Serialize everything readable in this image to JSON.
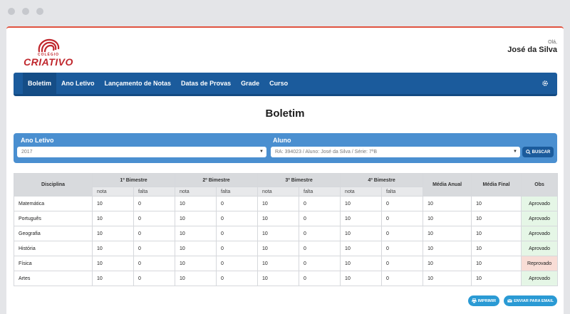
{
  "brand": {
    "small": "COLÉGIO",
    "big": "CRIATIVO",
    "color": "#c0272d"
  },
  "greeting": {
    "hi": "Olá,",
    "user": "José da Silva"
  },
  "nav": {
    "items": [
      "Boletim",
      "Ano Letivo",
      "Lançamento de Notas",
      "Datas de Provas",
      "Grade",
      "Curso"
    ],
    "active": "Boletim",
    "settings_icon": "gear-icon",
    "color": "#1b5b9c"
  },
  "page_title": "Boletim",
  "filter": {
    "year_label": "Ano Letivo",
    "year_value": "2017",
    "student_label": "Aluno",
    "student_value": "RA: 394023 / Aluno: José da Silva / Série: 7ºB",
    "search_label": "BUSCAR"
  },
  "table": {
    "headers": [
      "Disciplina",
      "1º Bimestre",
      "2º Bimestre",
      "3º Bimestre",
      "4º Bimestre",
      "Média Anual",
      "Média Final",
      "Obs"
    ],
    "sub": [
      "nota",
      "falta"
    ],
    "rows": [
      {
        "subject": "Matemática",
        "b1n": "10",
        "b1f": "0",
        "b2n": "10",
        "b2f": "0",
        "b3n": "10",
        "b3f": "0",
        "b4n": "10",
        "b4f": "0",
        "anual": "10",
        "final": "10",
        "obs": "Aprovado"
      },
      {
        "subject": "Português",
        "b1n": "10",
        "b1f": "0",
        "b2n": "10",
        "b2f": "0",
        "b3n": "10",
        "b3f": "0",
        "b4n": "10",
        "b4f": "0",
        "anual": "10",
        "final": "10",
        "obs": "Aprovado"
      },
      {
        "subject": "Geografia",
        "b1n": "10",
        "b1f": "0",
        "b2n": "10",
        "b2f": "0",
        "b3n": "10",
        "b3f": "0",
        "b4n": "10",
        "b4f": "0",
        "anual": "10",
        "final": "10",
        "obs": "Aprovado"
      },
      {
        "subject": "História",
        "b1n": "10",
        "b1f": "0",
        "b2n": "10",
        "b2f": "0",
        "b3n": "10",
        "b3f": "0",
        "b4n": "10",
        "b4f": "0",
        "anual": "10",
        "final": "10",
        "obs": "Aprovado"
      },
      {
        "subject": "Física",
        "b1n": "10",
        "b1f": "0",
        "b2n": "10",
        "b2f": "0",
        "b3n": "10",
        "b3f": "0",
        "b4n": "10",
        "b4f": "0",
        "anual": "10",
        "final": "10",
        "obs": "Reprovado"
      },
      {
        "subject": "Artes",
        "b1n": "10",
        "b1f": "0",
        "b2n": "10",
        "b2f": "0",
        "b3n": "10",
        "b3f": "0",
        "b4n": "10",
        "b4f": "0",
        "anual": "10",
        "final": "10",
        "obs": "Aprovado"
      }
    ]
  },
  "actions": {
    "print_label": "IMPRIMIR",
    "email_label": "ENVIAR PARA EMAIL"
  },
  "colors": {
    "approved_bg": "#e5f6e6",
    "failed_bg": "#f8ddd6",
    "accent": "#2a9ad4"
  }
}
